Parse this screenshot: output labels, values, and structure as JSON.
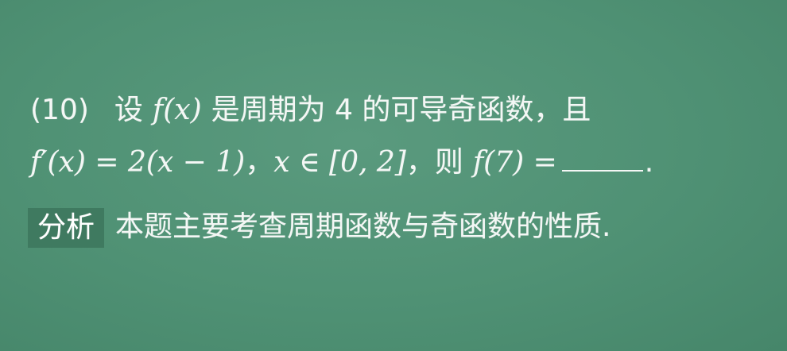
{
  "problem": {
    "number": "(10)",
    "lead": "设",
    "f_x": "f(x)",
    "text1": "是周期为 4 的可导奇函数，且",
    "derivative": "f′(x) = 2(x − 1)",
    "sep1": "，",
    "domain": "x ∈ [0, 2]",
    "sep2": "，则",
    "f7": "f(7) =",
    "end": "."
  },
  "analysis": {
    "tag": "分析",
    "text": "本题主要考查周期函数与奇函数的性质."
  }
}
